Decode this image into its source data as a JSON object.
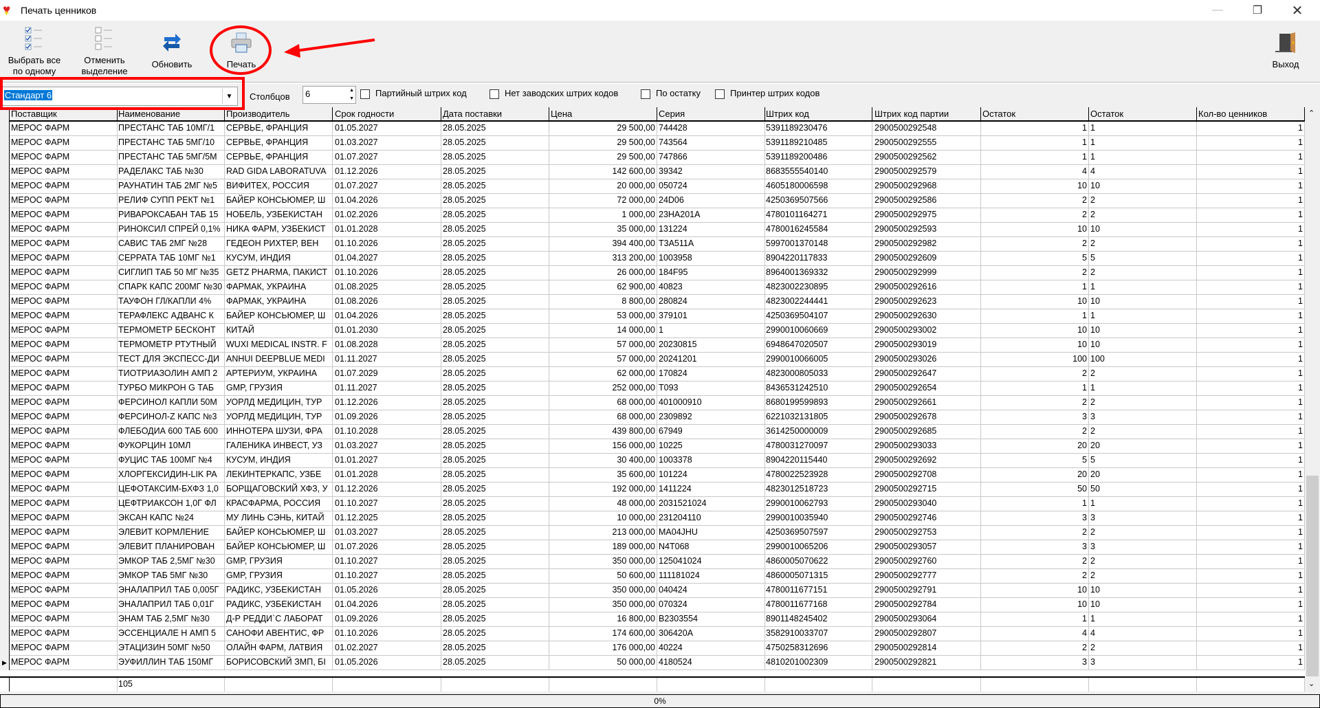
{
  "window": {
    "title": "Печать ценников"
  },
  "toolbar": {
    "select_all": "Выбрать все по одному",
    "deselect": "Отменить выделение",
    "refresh": "Обновить",
    "print": "Печать",
    "exit": "Выход"
  },
  "options": {
    "template_value": "Стандарт 6",
    "columns_label": "Столбцов",
    "columns_value": "6",
    "checkboxes": [
      {
        "label": "Партийный штрих код",
        "checked": false
      },
      {
        "label": "Нет заводских штрих кодов",
        "checked": false
      },
      {
        "label": "По остатку",
        "checked": false
      },
      {
        "label": "Принтер штрих кодов",
        "checked": false
      }
    ]
  },
  "grid": {
    "columns": [
      "Поставщик",
      "Наименование",
      "Производитель",
      "Срок годности",
      "Дата поставки",
      "Цена",
      "Серия",
      "Штрих код",
      "Штрих код партии",
      "Остаток",
      "Остаток",
      "Кол-во ценников"
    ],
    "rows": [
      [
        "МЕРОС ФАРМ",
        "ПРЕСТАНС ТАБ 10МГ/1",
        "СЕРВЬЕ, ФРАНЦИЯ",
        "01.05.2027",
        "28.05.2025",
        "29 500,00",
        "744428",
        "5391189230476",
        "2900500292548",
        "1",
        "1",
        "1"
      ],
      [
        "МЕРОС ФАРМ",
        "ПРЕСТАНС ТАБ 5МГ/10",
        "СЕРВЬЕ, ФРАНЦИЯ",
        "01.03.2027",
        "28.05.2025",
        "29 500,00",
        "743564",
        "5391189210485",
        "2900500292555",
        "1",
        "1",
        "1"
      ],
      [
        "МЕРОС ФАРМ",
        "ПРЕСТАНС ТАБ 5МГ/5М",
        "СЕРВЬЕ, ФРАНЦИЯ",
        "01.07.2027",
        "28.05.2025",
        "29 500,00",
        "747866",
        "5391189200486",
        "2900500292562",
        "1",
        "1",
        "1"
      ],
      [
        "МЕРОС ФАРМ",
        "РАДЕЛАКС ТАБ №30",
        "RAD GIDA LABORATUVA",
        "01.12.2026",
        "28.05.2025",
        "142 600,00",
        "39342",
        "8683555540140",
        "2900500292579",
        "4",
        "4",
        "1"
      ],
      [
        "МЕРОС ФАРМ",
        "РАУНАТИН ТАБ 2МГ №5",
        "ВИФИТЕХ, РОССИЯ",
        "01.07.2027",
        "28.05.2025",
        "20 000,00",
        "050724",
        "4605180006598",
        "2900500292968",
        "10",
        "10",
        "1"
      ],
      [
        "МЕРОС ФАРМ",
        "РЕЛИФ СУПП РЕКТ №1",
        "БАЙЕР КОНСЬЮМЕР, Ш",
        "01.04.2026",
        "28.05.2025",
        "72 000,00",
        "24D06",
        "4250369507566",
        "2900500292586",
        "2",
        "2",
        "1"
      ],
      [
        "МЕРОС ФАРМ",
        "РИВАРОКСАБАН ТАБ 15",
        "НОБЕЛЬ, УЗБЕКИСТАН",
        "01.02.2026",
        "28.05.2025",
        "1 000,00",
        "23HA201A",
        "4780101164271",
        "2900500292975",
        "2",
        "2",
        "1"
      ],
      [
        "МЕРОС ФАРМ",
        "РИНОКСИЛ СПРЕЙ 0,1%",
        "НИКА ФАРМ, УЗБЕКИСТ",
        "01.01.2028",
        "28.05.2025",
        "35 000,00",
        "131224",
        "4780016245584",
        "2900500292593",
        "10",
        "10",
        "1"
      ],
      [
        "МЕРОС ФАРМ",
        "САВИС ТАБ 2МГ №28",
        "ГЕДЕОН РИХТЕР, ВЕН",
        "01.10.2026",
        "28.05.2025",
        "394 400,00",
        "T3A511A",
        "5997001370148",
        "2900500292982",
        "2",
        "2",
        "1"
      ],
      [
        "МЕРОС ФАРМ",
        "СЕРРАТА ТАБ 10МГ №1",
        "КУСУМ, ИНДИЯ",
        "01.04.2027",
        "28.05.2025",
        "313 200,00",
        "1003958",
        "8904220117833",
        "2900500292609",
        "5",
        "5",
        "1"
      ],
      [
        "МЕРОС ФАРМ",
        "СИГЛИП ТАБ 50 МГ №35",
        "GETZ PHARMA, ПАКИСТ",
        "01.10.2026",
        "28.05.2025",
        "26 000,00",
        "184F95",
        "8964001369332",
        "2900500292999",
        "2",
        "2",
        "1"
      ],
      [
        "МЕРОС ФАРМ",
        "СПАРК КАПС 200МГ №30",
        "ФАРМАК, УКРАИНА",
        "01.08.2025",
        "28.05.2025",
        "62 900,00",
        "40823",
        "4823002230895",
        "2900500292616",
        "1",
        "1",
        "1"
      ],
      [
        "МЕРОС ФАРМ",
        "ТАУФОН ГЛ/КАПЛИ 4%",
        "ФАРМАК, УКРАИНА",
        "01.08.2026",
        "28.05.2025",
        "8 800,00",
        "280824",
        "4823002244441",
        "2900500292623",
        "10",
        "10",
        "1"
      ],
      [
        "МЕРОС ФАРМ",
        "ТЕРАФЛЕКС АДВАНС К",
        "БАЙЕР КОНСЬЮМЕР, Ш",
        "01.04.2026",
        "28.05.2025",
        "53 000,00",
        "379101",
        "4250369504107",
        "2900500292630",
        "1",
        "1",
        "1"
      ],
      [
        "МЕРОС ФАРМ",
        "ТЕРМОМЕТР БЕСКОНТ",
        "КИТАЙ",
        "01.01.2030",
        "28.05.2025",
        "14 000,00",
        "1",
        "2990010060669",
        "2900500293002",
        "10",
        "10",
        "1"
      ],
      [
        "МЕРОС ФАРМ",
        "ТЕРМОМЕТР РТУТНЫЙ",
        "WUXI MEDICAL INSTR. F",
        "01.08.2028",
        "28.05.2025",
        "57 000,00",
        "20230815",
        "6948647020507",
        "2900500293019",
        "10",
        "10",
        "1"
      ],
      [
        "МЕРОС ФАРМ",
        "ТЕСТ ДЛЯ ЭКСПЕСС-ДИ",
        "ANHUI DEEPBLUE MEDI",
        "01.11.2027",
        "28.05.2025",
        "57 000,00",
        "20241201",
        "2990010066005",
        "2900500293026",
        "100",
        "100",
        "1"
      ],
      [
        "МЕРОС ФАРМ",
        "ТИОТРИАЗОЛИН АМП 2",
        "АРТЕРИУМ, УКРАИНА",
        "01.07.2029",
        "28.05.2025",
        "62 000,00",
        "170824",
        "4823000805033",
        "2900500292647",
        "2",
        "2",
        "1"
      ],
      [
        "МЕРОС ФАРМ",
        "ТУРБО МИКРОН G ТАБ",
        "GMP, ГРУЗИЯ",
        "01.11.2027",
        "28.05.2025",
        "252 000,00",
        "T093",
        "8436531242510",
        "2900500292654",
        "1",
        "1",
        "1"
      ],
      [
        "МЕРОС ФАРМ",
        "ФЕРСИНОЛ КАПЛИ 50М",
        "УОРЛД МЕДИЦИН, ТУР",
        "01.12.2026",
        "28.05.2025",
        "68 000,00",
        "401000910",
        "8680199599893",
        "2900500292661",
        "2",
        "2",
        "1"
      ],
      [
        "МЕРОС ФАРМ",
        "ФЕРСИНОЛ-Z КАПС №3",
        "УОРЛД МЕДИЦИН, ТУР",
        "01.09.2026",
        "28.05.2025",
        "68 000,00",
        "2309892",
        "6221032131805",
        "2900500292678",
        "3",
        "3",
        "1"
      ],
      [
        "МЕРОС ФАРМ",
        "ФЛЕБОДИА 600 ТАБ 600",
        "ИННОТЕРА ШУЗИ, ФРА",
        "01.10.2028",
        "28.05.2025",
        "439 800,00",
        "67949",
        "3614250000009",
        "2900500292685",
        "2",
        "2",
        "1"
      ],
      [
        "МЕРОС ФАРМ",
        "ФУКОРЦИН 10МЛ",
        "ГАЛЕНИКА ИНВЕСТ, УЗ",
        "01.03.2027",
        "28.05.2025",
        "156 000,00",
        "10225",
        "4780031270097",
        "2900500293033",
        "20",
        "20",
        "1"
      ],
      [
        "МЕРОС ФАРМ",
        "ФУЦИС ТАБ 100МГ №4",
        "КУСУМ, ИНДИЯ",
        "01.01.2027",
        "28.05.2025",
        "30 400,00",
        "1003378",
        "8904220115440",
        "2900500292692",
        "5",
        "5",
        "1"
      ],
      [
        "МЕРОС ФАРМ",
        "ХЛОРГЕКСИДИН-LIK РА",
        "ЛЕКИНТЕРКАПС, УЗБЕ",
        "01.01.2028",
        "28.05.2025",
        "35 600,00",
        "101224",
        "4780022523928",
        "2900500292708",
        "20",
        "20",
        "1"
      ],
      [
        "МЕРОС ФАРМ",
        "ЦЕФОТАКСИМ-БХФЗ 1,0",
        "БОРЩАГОВСКИЙ ХФЗ, У",
        "01.12.2026",
        "28.05.2025",
        "192 000,00",
        "1411224",
        "4823012518723",
        "2900500292715",
        "50",
        "50",
        "1"
      ],
      [
        "МЕРОС ФАРМ",
        "ЦЕФТРИАКСОН 1,0Г ФЛ",
        "КРАСФАРМА, РОССИЯ",
        "01.10.2027",
        "28.05.2025",
        "48 000,00",
        "2031521024",
        "2990010062793",
        "2900500293040",
        "1",
        "1",
        "1"
      ],
      [
        "МЕРОС ФАРМ",
        "ЭКСАН КАПС №24",
        "МУ ЛИНЬ СЭНЬ, КИТАЙ",
        "01.12.2025",
        "28.05.2025",
        "10 000,00",
        "231204110",
        "2990010035940",
        "2900500292746",
        "3",
        "3",
        "1"
      ],
      [
        "МЕРОС ФАРМ",
        "ЭЛЕВИТ КОРМЛЕНИЕ",
        "БАЙЕР КОНСЬЮМЕР, Ш",
        "01.03.2027",
        "28.05.2025",
        "213 000,00",
        "MA04JHU",
        "4250369507597",
        "2900500292753",
        "2",
        "2",
        "1"
      ],
      [
        "МЕРОС ФАРМ",
        "ЭЛЕВИТ ПЛАНИРОВАН",
        "БАЙЕР КОНСЬЮМЕР, Ш",
        "01.07.2026",
        "28.05.2025",
        "189 000,00",
        "N4T068",
        "2990010065206",
        "2900500293057",
        "3",
        "3",
        "1"
      ],
      [
        "МЕРОС ФАРМ",
        "ЭМКОР ТАБ 2,5МГ №30",
        "GMP, ГРУЗИЯ",
        "01.10.2027",
        "28.05.2025",
        "350 000,00",
        "125041024",
        "4860005070622",
        "2900500292760",
        "2",
        "2",
        "1"
      ],
      [
        "МЕРОС ФАРМ",
        "ЭМКОР ТАБ 5МГ №30",
        "GMP, ГРУЗИЯ",
        "01.10.2027",
        "28.05.2025",
        "50 600,00",
        "111181024",
        "4860005071315",
        "2900500292777",
        "2",
        "2",
        "1"
      ],
      [
        "МЕРОС ФАРМ",
        "ЭНАЛАПРИЛ ТАБ 0,005Г",
        "РАДИКС, УЗБЕКИСТАН",
        "01.05.2026",
        "28.05.2025",
        "350 000,00",
        "040424",
        "4780011677151",
        "2900500292791",
        "10",
        "10",
        "1"
      ],
      [
        "МЕРОС ФАРМ",
        "ЭНАЛАПРИЛ ТАБ 0,01Г",
        "РАДИКС, УЗБЕКИСТАН",
        "01.04.2026",
        "28.05.2025",
        "350 000,00",
        "070324",
        "4780011677168",
        "2900500292784",
        "10",
        "10",
        "1"
      ],
      [
        "МЕРОС ФАРМ",
        "ЭНАМ ТАБ 2,5МГ №30",
        "Д-Р РЕДДИ`С ЛАБОРАТ",
        "01.09.2026",
        "28.05.2025",
        "16 800,00",
        "B2303554",
        "8901148245402",
        "2900500293064",
        "1",
        "1",
        "1"
      ],
      [
        "МЕРОС ФАРМ",
        "ЭССЕНЦИАЛЕ Н АМП 5",
        "САНОФИ АВЕНТИС, ФР",
        "01.10.2026",
        "28.05.2025",
        "174 600,00",
        "306420A",
        "3582910033707",
        "2900500292807",
        "4",
        "4",
        "1"
      ],
      [
        "МЕРОС ФАРМ",
        "ЭТАЦИЗИН 50МГ №50",
        "ОЛАЙН ФАРМ, ЛАТВИЯ",
        "01.02.2027",
        "28.05.2025",
        "176 000,00",
        "40224",
        "4750258312696",
        "2900500292814",
        "2",
        "2",
        "1"
      ],
      [
        "МЕРОС ФАРМ",
        "ЭУФИЛЛИН ТАБ 150МГ",
        "БОРИСОВСКИЙ ЗМП, БІ",
        "01.05.2026",
        "28.05.2025",
        "50 000,00",
        "4180524",
        "4810201002309",
        "2900500292821",
        "3",
        "3",
        "1"
      ]
    ],
    "footer_count": "105"
  },
  "status": {
    "progress_text": "0%",
    "progress": 0
  },
  "colors": {
    "annotation": "#ff0000",
    "selection": "#0078d7"
  }
}
